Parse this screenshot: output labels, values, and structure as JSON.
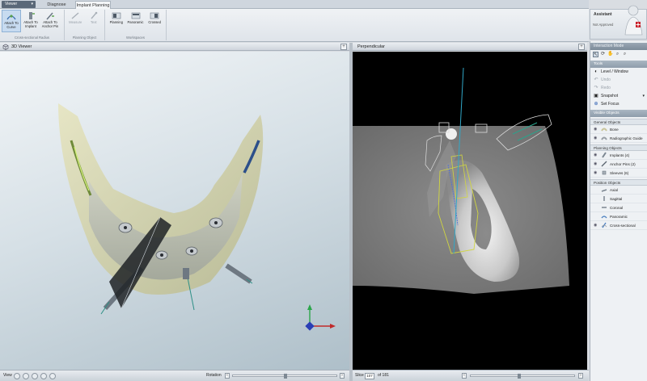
{
  "tabs": {
    "app_menu": "Viewer",
    "items": [
      "Diagnose",
      "Implant Planning"
    ],
    "active": "Implant Planning"
  },
  "ribbon": {
    "groups": [
      {
        "label": "Cross-sectional Radius",
        "buttons": [
          {
            "label": "Attach To Curve",
            "selected": true,
            "enabled": true,
            "icon": "curve-attach-icon"
          },
          {
            "label": "Attach To Implant",
            "selected": false,
            "enabled": true,
            "icon": "implant-attach-icon"
          },
          {
            "label": "Attach To Anchor Pin",
            "selected": false,
            "enabled": true,
            "icon": "anchor-pin-attach-icon"
          }
        ]
      },
      {
        "label": "Planning Object",
        "buttons": [
          {
            "label": "Measure",
            "selected": false,
            "enabled": false,
            "icon": "measure-icon"
          },
          {
            "label": "Text",
            "selected": false,
            "enabled": false,
            "icon": "text-icon"
          }
        ]
      },
      {
        "label": "Workspaces",
        "buttons": [
          {
            "label": "Planning",
            "selected": false,
            "enabled": true,
            "icon": "planning-workspace-icon"
          },
          {
            "label": "Panoramic",
            "selected": false,
            "enabled": true,
            "icon": "panoramic-workspace-icon"
          },
          {
            "label": "Crossed",
            "selected": false,
            "enabled": true,
            "icon": "crossed-workspace-icon"
          }
        ]
      }
    ]
  },
  "assistant": {
    "title": "Assistant",
    "status": "Not Approved"
  },
  "panels": {
    "left_title": "3D Viewer",
    "right_title": "Perpendicular"
  },
  "bottom_left": {
    "view_label": "View",
    "rotation_label": "Rotation"
  },
  "bottom_right": {
    "slice_label": "Slice",
    "slice_value": "107",
    "slice_total": "of 181"
  },
  "right_pane": {
    "header": "Interaction Mode",
    "mode_icons": [
      "select-icon",
      "rotate-icon",
      "pan-icon",
      "zoom-icon",
      "zoom-window-icon"
    ],
    "tools_header": "Tools",
    "tools": [
      {
        "label": "Level / Window",
        "enabled": true,
        "icon": "level-window-icon"
      },
      {
        "label": "Undo",
        "enabled": false,
        "icon": "undo-icon"
      },
      {
        "label": "Redo",
        "enabled": false,
        "icon": "redo-icon"
      },
      {
        "label": "Snapshot",
        "enabled": true,
        "icon": "camera-icon"
      },
      {
        "label": "Set Focus",
        "enabled": true,
        "icon": "focus-icon"
      }
    ],
    "objects_header": "Visible Objects",
    "sections": [
      {
        "title": "General Objects",
        "items": [
          {
            "label": "Bone",
            "visible": true,
            "icon": "bone-icon"
          },
          {
            "label": "Radiographic Guide",
            "visible": true,
            "icon": "guide-icon"
          }
        ]
      },
      {
        "title": "Planning Objects",
        "items": [
          {
            "label": "Implants (4)",
            "visible": true,
            "icon": "implant-icon"
          },
          {
            "label": "Anchor Pins (2)",
            "visible": true,
            "icon": "anchor-pin-icon"
          },
          {
            "label": "Sleeves (6)",
            "visible": true,
            "icon": "sleeve-icon"
          }
        ]
      },
      {
        "title": "Position Objects",
        "items": [
          {
            "label": "Axial",
            "visible": false,
            "icon": "axial-icon"
          },
          {
            "label": "Sagittal",
            "visible": false,
            "icon": "sagittal-icon"
          },
          {
            "label": "Coronal",
            "visible": false,
            "icon": "coronal-icon"
          },
          {
            "label": "Panoramic",
            "visible": false,
            "icon": "panoramic-icon"
          },
          {
            "label": "Cross-sectional",
            "visible": true,
            "icon": "cross-sectional-icon"
          }
        ]
      }
    ]
  },
  "colors": {
    "accent": "#5a6878",
    "selection": "#c7dbf0",
    "pane_header": "#8695a3"
  }
}
